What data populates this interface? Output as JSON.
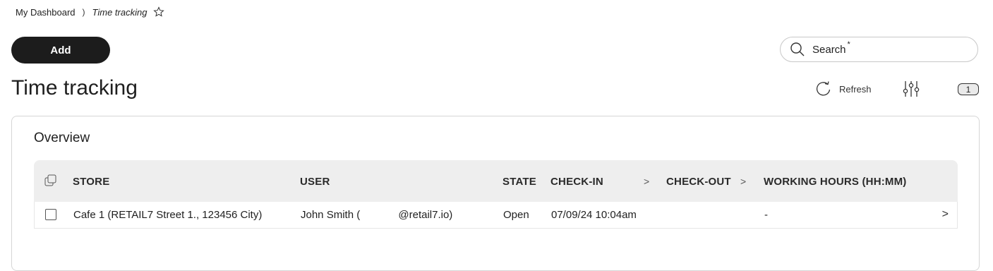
{
  "breadcrumb": {
    "home": "My Dashboard",
    "separator": ")",
    "current": "Time tracking"
  },
  "toolbar": {
    "add_label": "Add"
  },
  "search": {
    "placeholder": "Search",
    "required_mark": "*"
  },
  "page": {
    "title": "Time tracking"
  },
  "actions": {
    "refresh_label": "Refresh",
    "filter_count": "1"
  },
  "overview": {
    "title": "Overview",
    "columns": {
      "store": "STORE",
      "user": "USER",
      "state": "STATE",
      "checkin": "CHECK-IN",
      "checkout": "CHECK-OUT",
      "hours": "WORKING HOURS (HH:MM)"
    },
    "sort_glyph": ">",
    "rows": [
      {
        "store": "Cafe 1 (RETAIL7 Street 1., 123456 City)",
        "user": "John Smith (             @retail7.io)",
        "state": "Open",
        "checkin": "07/09/24 10:04am",
        "checkout": "",
        "hours": "-",
        "arrow": ">"
      }
    ]
  }
}
